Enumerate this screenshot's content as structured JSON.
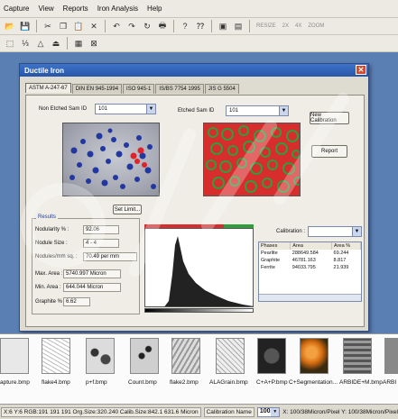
{
  "menu": [
    "Capture",
    "View",
    "Reports",
    "Iron Analysis",
    "Help"
  ],
  "toolbar": {
    "resize_label": "RESIZE",
    "zoom2x_label": "2X",
    "zoom4x_label": "4X",
    "zoom_label": "ZOOM"
  },
  "dialog": {
    "title": "Ductile Iron",
    "tabs": [
      "ASTM A-247-67",
      "DIN EN 945-1994",
      "ISO 945-1",
      "IS/BS 7754 1995",
      "JIS G 5504"
    ],
    "non_etched_label": "Non Etched Sam ID",
    "non_etched_value": "101",
    "etched_label": "Etched Sam ID",
    "etched_value": "101",
    "new_calibration_button": "New Calibration",
    "report_button": "Report",
    "set_limit_button": "Set Limit...",
    "calibration_label": "Calibration :",
    "calibration_value": "",
    "results": {
      "title": "Results",
      "nodularity_label": "Nodularity % :",
      "nodularity_value": "92.06",
      "nodule_size_label": "Nodule Size :",
      "nodule_size_value": "4 - 4",
      "nodules_mm_label": "Nodules/mm sq. :",
      "nodules_mm_value": "70.49 per mm",
      "max_area_label": "Max. Area :",
      "max_area_value": "5740.997 Micron",
      "min_area_label": "Min. Area :",
      "min_area_value": "644.044 Micron",
      "graphite_label": "Graphite % :",
      "graphite_value": "6.62"
    },
    "phase_table": {
      "headers": [
        "Phases",
        "Area",
        "Area %"
      ],
      "rows": [
        [
          "Pearlite",
          "288649.584",
          "69.244"
        ],
        [
          "Graphite",
          "46781.163",
          "8.817"
        ],
        [
          "Ferrite",
          "94033.795",
          "21.939"
        ]
      ]
    }
  },
  "gallery": [
    {
      "label": "apture.bmp",
      "icon": "micrograph-thumbnail"
    },
    {
      "label": "flake4.bmp",
      "icon": "micrograph-thumbnail"
    },
    {
      "label": "p+f.bmp",
      "icon": "micrograph-thumbnail"
    },
    {
      "label": "Count.bmp",
      "icon": "micrograph-thumbnail"
    },
    {
      "label": "flake2.bmp",
      "icon": "micrograph-thumbnail"
    },
    {
      "label": "ALAGrain.bmp",
      "icon": "micrograph-thumbnail"
    },
    {
      "label": "C+A+P.bmp",
      "icon": "micrograph-thumbnail"
    },
    {
      "label": "C+Segmentation...",
      "icon": "micrograph-thumbnail"
    },
    {
      "label": "ARBIDE+M.bmp",
      "icon": "micrograph-thumbnail"
    },
    {
      "label": "ARBI",
      "icon": "micrograph-thumbnail"
    }
  ],
  "statusbar": {
    "coords": "X:6 Y:6 RGB:191 191 191 Org.Size:320.240 Calib.Size:842.1 631.6 Micron",
    "calibration_label": "Calibration Name",
    "zoom_value": "100X",
    "scale_text": "X: 100/38Micron/Pixel Y: 100/38Micron/Pixel"
  },
  "colors": {
    "title_blue": "#2556a8",
    "etched_red": "#d82d2d",
    "graphite_green": "#2f9e3d",
    "nodule_blue": "#2238a0"
  }
}
